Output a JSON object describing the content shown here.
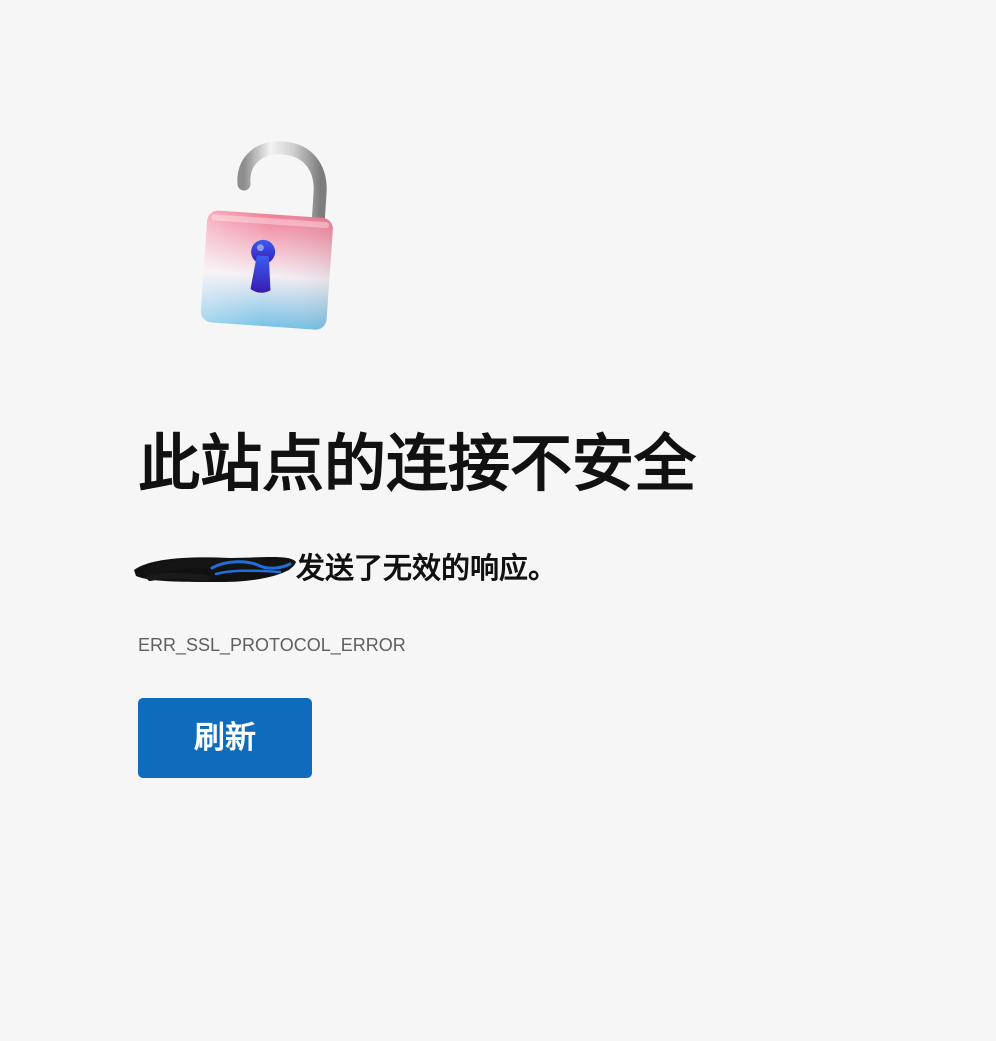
{
  "error_page": {
    "title": "此站点的连接不安全",
    "message": "发送了无效的响应。",
    "error_code": "ERR_SSL_PROTOCOL_ERROR",
    "refresh_label": "刷新",
    "illustration_icon": "unlocked-padlock-icon"
  },
  "colors": {
    "background": "#f6f6f6",
    "title_text": "#111111",
    "error_code_text": "#5e5e5e",
    "button_background": "#0f6cbd",
    "button_text": "#ffffff",
    "padlock_top": "#f07f9a",
    "padlock_bottom": "#8ccbe8",
    "keyhole": "#2a2ad0"
  }
}
